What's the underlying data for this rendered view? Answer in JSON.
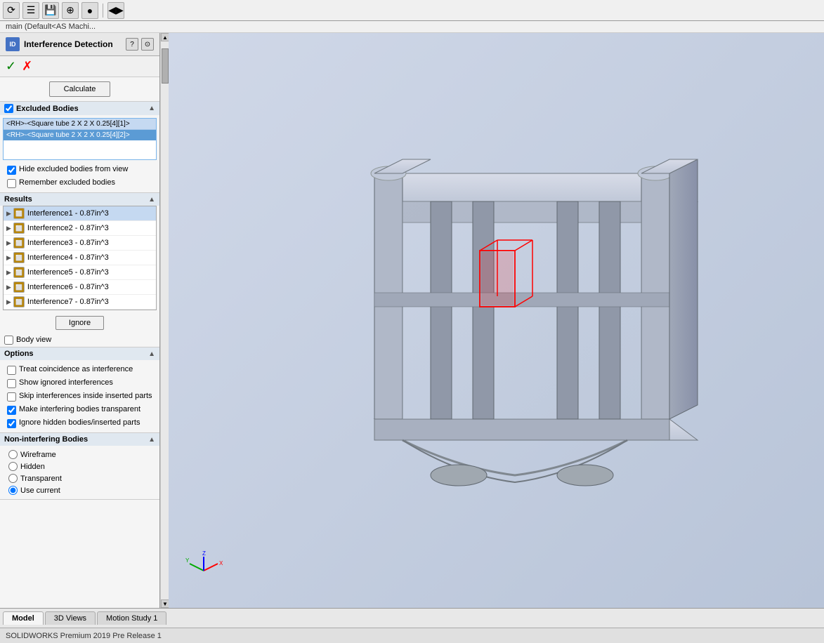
{
  "topToolbar": {
    "icons": [
      "⟳",
      "☰",
      "💾",
      "✛",
      "🎨",
      "◀▶"
    ]
  },
  "breadcrumb": {
    "text": "main (Default<AS Machi..."
  },
  "panel": {
    "title": "Interference Detection",
    "accept_label": "✓",
    "cancel_label": "✗",
    "calculate_label": "Calculate"
  },
  "excludedBodies": {
    "title": "Excluded Bodies",
    "items": [
      {
        "text": "<RH>-<Square tube 2 X 2 X 0.25[4][1]>",
        "selected": false
      },
      {
        "text": "<RH>-<Square tube 2 X 2 X 0.25[4][2]>",
        "selected": true
      }
    ],
    "checkbox1_label": "Hide excluded bodies from view",
    "checkbox1_checked": true,
    "checkbox2_label": "Remember excluded bodies",
    "checkbox2_checked": false
  },
  "results": {
    "title": "Results",
    "items": [
      {
        "label": "Interference1 - 0.87in^3",
        "selected": true
      },
      {
        "label": "Interference2 - 0.87in^3",
        "selected": false
      },
      {
        "label": "Interference3 - 0.87in^3",
        "selected": false
      },
      {
        "label": "Interference4 - 0.87in^3",
        "selected": false
      },
      {
        "label": "Interference5 - 0.87in^3",
        "selected": false
      },
      {
        "label": "Interference6 - 0.87in^3",
        "selected": false
      },
      {
        "label": "Interference7 - 0.87in^3",
        "selected": false
      }
    ],
    "ignore_label": "Ignore",
    "body_view_label": "Body view"
  },
  "options": {
    "title": "Options",
    "items": [
      {
        "label": "Treat coincidence as interference",
        "checked": false
      },
      {
        "label": "Show ignored interferences",
        "checked": false
      },
      {
        "label": "Skip interferences inside inserted parts",
        "checked": false
      },
      {
        "label": "Make interfering bodies transparent",
        "checked": true
      },
      {
        "label": "Ignore hidden bodies/inserted parts",
        "checked": true
      }
    ]
  },
  "nonInterferingBodies": {
    "title": "Non-interfering Bodies",
    "options": [
      {
        "label": "Wireframe",
        "selected": false
      },
      {
        "label": "Hidden",
        "selected": false
      },
      {
        "label": "Transparent",
        "selected": false
      },
      {
        "label": "Use current",
        "selected": true
      }
    ]
  },
  "bottomTabs": {
    "tabs": [
      "Model",
      "3D Views",
      "Motion Study 1"
    ],
    "activeTab": "Model"
  },
  "statusBar": {
    "text": "SOLIDWORKS Premium 2019 Pre Release 1"
  }
}
